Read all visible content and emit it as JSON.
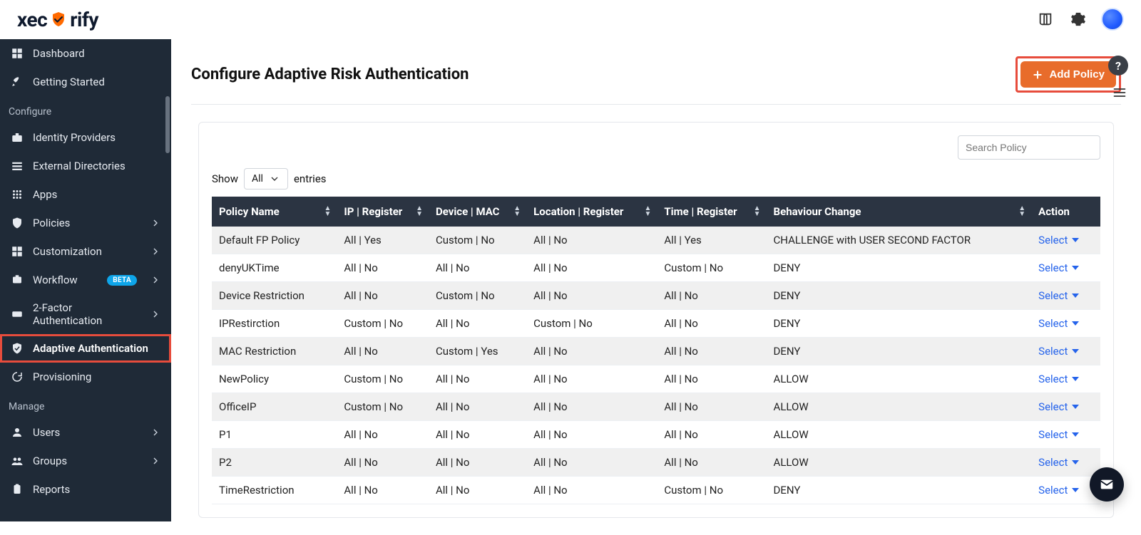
{
  "brand": {
    "name": "xecurify"
  },
  "header": {
    "page_title": "Configure Adaptive Risk Authentication",
    "add_policy_label": "Add Policy"
  },
  "search": {
    "placeholder": "Search Policy"
  },
  "entries": {
    "show_label": "Show",
    "select_value": "All",
    "entries_label": "entries"
  },
  "sidebar": {
    "configure_label": "Configure",
    "manage_label": "Manage",
    "items": [
      {
        "label": "Dashboard"
      },
      {
        "label": "Getting Started"
      },
      {
        "label": "Identity Providers"
      },
      {
        "label": "External Directories"
      },
      {
        "label": "Apps"
      },
      {
        "label": "Policies"
      },
      {
        "label": "Customization"
      },
      {
        "label": "Workflow",
        "badge": "BETA"
      },
      {
        "label": "2-Factor Authentication"
      },
      {
        "label": "Adaptive Authentication"
      },
      {
        "label": "Provisioning"
      },
      {
        "label": "Users"
      },
      {
        "label": "Groups"
      },
      {
        "label": "Reports"
      }
    ]
  },
  "table": {
    "columns": [
      "Policy Name",
      "IP | Register",
      "Device | MAC",
      "Location | Register",
      "Time | Register",
      "Behaviour Change",
      "Action"
    ],
    "action_label": "Select",
    "rows": [
      {
        "name": "Default FP Policy",
        "ip": "All | Yes",
        "device": "Custom | No",
        "location": "All | No",
        "time": "All | Yes",
        "behaviour": "CHALLENGE with USER SECOND FACTOR"
      },
      {
        "name": "denyUKTime",
        "ip": "All | No",
        "device": "All | No",
        "location": "All | No",
        "time": "Custom | No",
        "behaviour": "DENY"
      },
      {
        "name": "Device Restriction",
        "ip": "All | No",
        "device": "Custom | No",
        "location": "All | No",
        "time": "All | No",
        "behaviour": "DENY"
      },
      {
        "name": "IPRestirction",
        "ip": "Custom | No",
        "device": "All | No",
        "location": "Custom | No",
        "time": "All | No",
        "behaviour": "DENY"
      },
      {
        "name": "MAC Restriction",
        "ip": "All | No",
        "device": "Custom | Yes",
        "location": "All | No",
        "time": "All | No",
        "behaviour": "DENY"
      },
      {
        "name": "NewPolicy",
        "ip": "Custom | No",
        "device": "All | No",
        "location": "All | No",
        "time": "All | No",
        "behaviour": "ALLOW"
      },
      {
        "name": "OfficeIP",
        "ip": "Custom | No",
        "device": "All | No",
        "location": "All | No",
        "time": "All | No",
        "behaviour": "ALLOW"
      },
      {
        "name": "P1",
        "ip": "All | No",
        "device": "All | No",
        "location": "All | No",
        "time": "All | No",
        "behaviour": "ALLOW"
      },
      {
        "name": "P2",
        "ip": "All | No",
        "device": "All | No",
        "location": "All | No",
        "time": "All | No",
        "behaviour": "ALLOW"
      },
      {
        "name": "TimeRestriction",
        "ip": "All | No",
        "device": "All | No",
        "location": "All | No",
        "time": "Custom | No",
        "behaviour": "DENY"
      }
    ]
  }
}
